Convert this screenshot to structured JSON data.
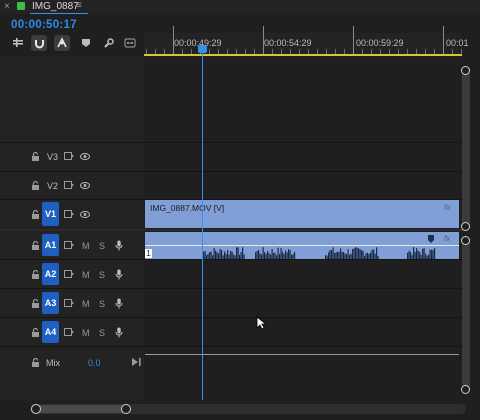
{
  "tab": {
    "title": "IMG_0887",
    "close": "×",
    "menu": "≡",
    "color": "#3fbf3f"
  },
  "timecode": "00:00:50:17",
  "ruler": {
    "labels": [
      "00:00:49:29",
      "00:00:54:29",
      "00:00:59:29",
      "00:01"
    ]
  },
  "tracks": {
    "video": [
      {
        "name": "V3"
      },
      {
        "name": "V2"
      },
      {
        "name": "V1",
        "target": "V1"
      }
    ],
    "audio": [
      {
        "name": "A1",
        "target": "A1"
      },
      {
        "name": "A2",
        "target": "A2"
      },
      {
        "name": "A3",
        "target": "A3"
      },
      {
        "name": "A4",
        "target": "A4"
      }
    ],
    "mix": {
      "label": "Mix",
      "value": "0.0"
    },
    "m_label": "M",
    "s_label": "S"
  },
  "clips": {
    "video_label": "IMG_0887.MOV [V]",
    "fx": "fx",
    "audio_channel": "1"
  },
  "colors": {
    "accent": "#2d8ceb",
    "clip": "#7f9fd6",
    "target": "#1f5fc2"
  }
}
